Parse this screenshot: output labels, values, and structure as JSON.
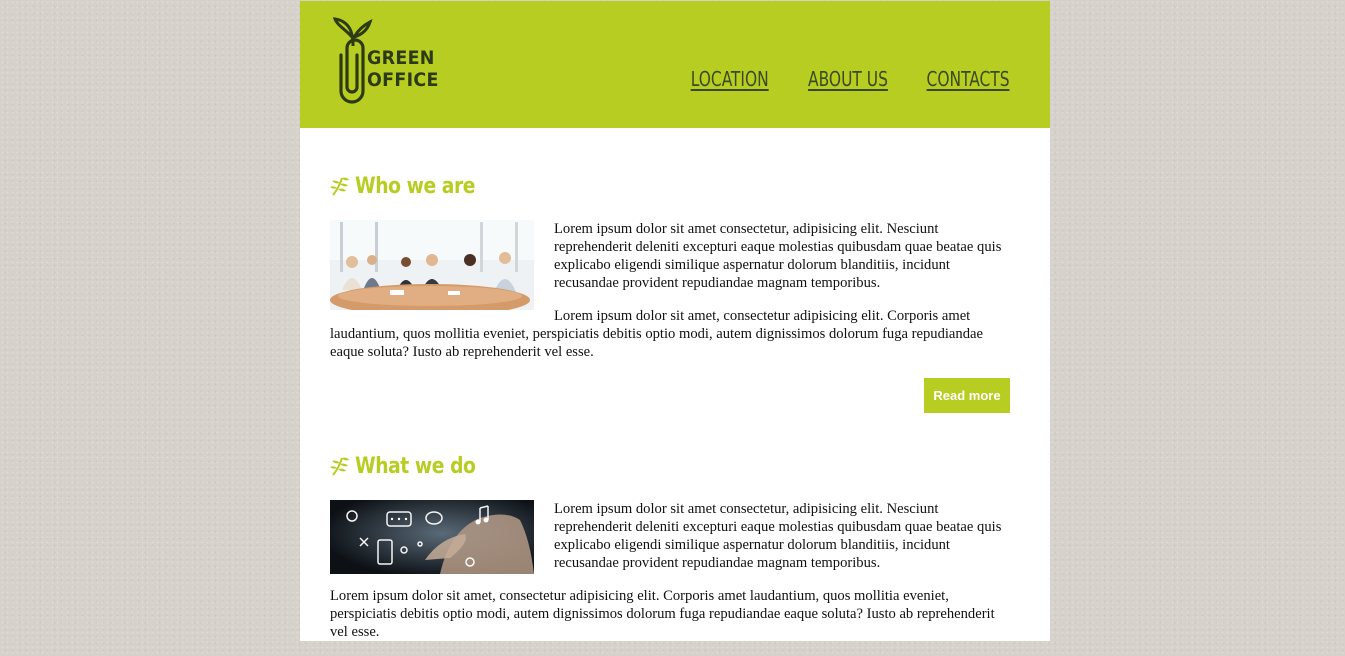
{
  "brand": {
    "line1": "GREEN",
    "line2": "OFFICE",
    "accent_color": "#b8cd22",
    "dark_color": "#2d3a16"
  },
  "nav": {
    "items": [
      {
        "label": "LOCATION"
      },
      {
        "label": "ABOUT US"
      },
      {
        "label": "CONTACTS"
      }
    ]
  },
  "sections": [
    {
      "title": "Who we are",
      "image_icon": "business-team-photo",
      "paragraphs": [
        "Lorem ipsum dolor sit amet consectetur, adipisicing elit. Nesciunt reprehenderit deleniti excepturi eaque molestias quibusdam quae beatae quis explicabo eligendi similique aspernatur dolorum blanditiis, incidunt recusandae provident repudiandae magnam temporibus.",
        "Lorem ipsum dolor sit amet, consectetur adipisicing elit. Corporis amet laudantium, quos mollitia eveniet, perspiciatis debitis optio modi, autem dignissimos dolorum fuga repudiandae eaque soluta? Iusto ab reprehenderit vel esse."
      ],
      "button_label": "Read more"
    },
    {
      "title": "What we do",
      "image_icon": "touchscreen-icons-photo",
      "paragraphs": [
        "Lorem ipsum dolor sit amet consectetur, adipisicing elit. Nesciunt reprehenderit deleniti excepturi eaque molestias quibusdam quae beatae quis explicabo eligendi similique aspernatur dolorum blanditiis, incidunt recusandae provident repudiandae magnam temporibus.",
        "Lorem ipsum dolor sit amet, consectetur adipisicing elit. Corporis amet laudantium, quos mollitia eveniet, perspiciatis debitis optio modi, autem dignissimos dolorum fuga repudiandae eaque soluta? Iusto ab reprehenderit vel esse."
      ]
    }
  ]
}
